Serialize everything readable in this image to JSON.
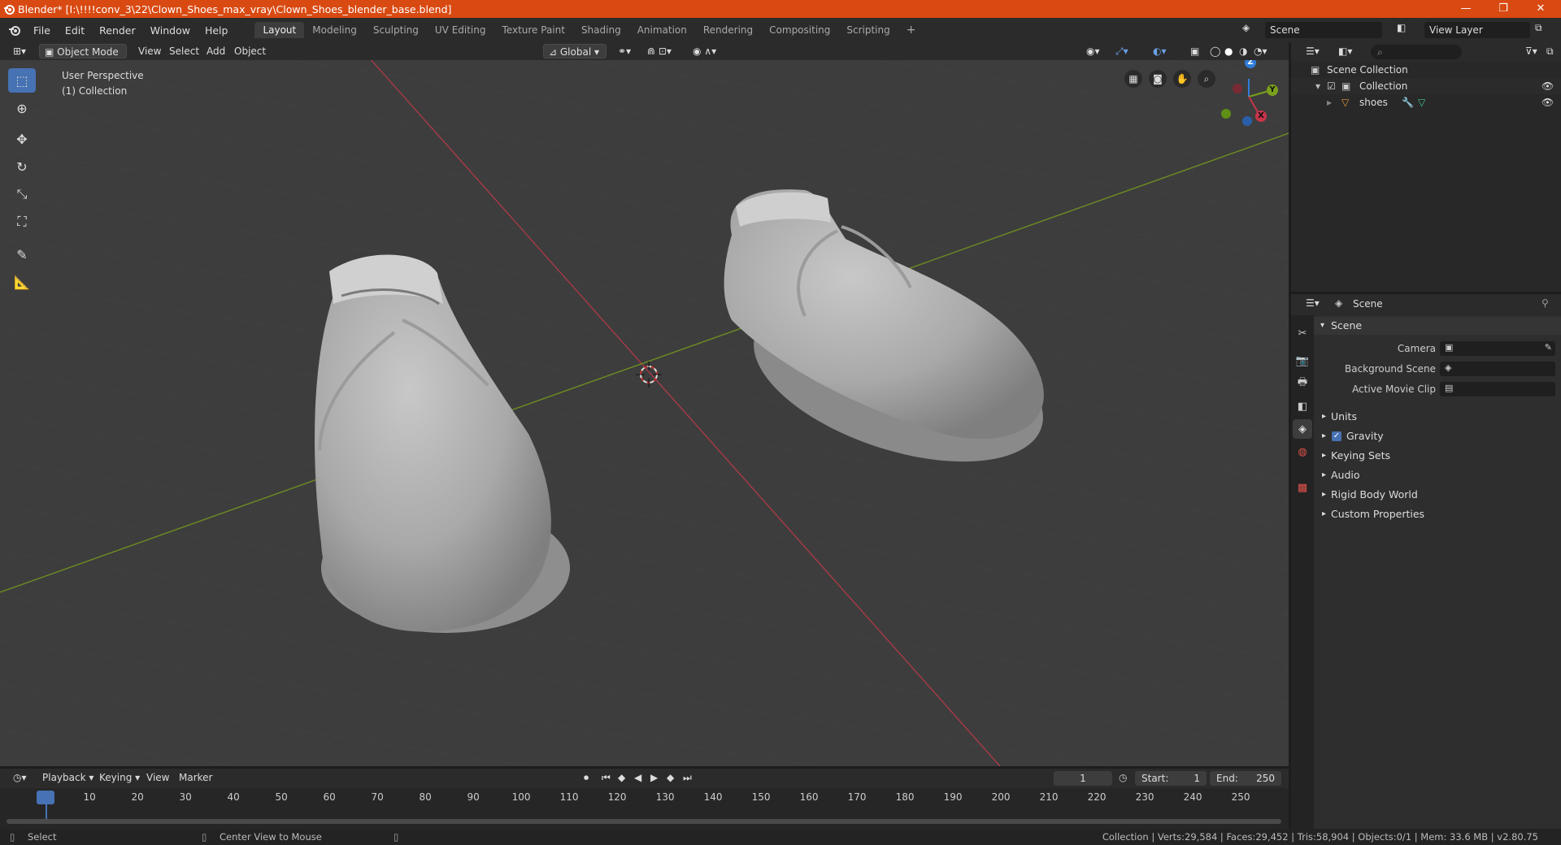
{
  "window": {
    "title": "Blender* [I:\\!!!!conv_3\\22\\Clown_Shoes_max_vray\\Clown_Shoes_blender_base.blend]",
    "controls": [
      "—",
      "❐",
      "✕"
    ]
  },
  "menu": {
    "items": [
      "File",
      "Edit",
      "Render",
      "Window",
      "Help"
    ],
    "workspaces": [
      "Layout",
      "Modeling",
      "Sculpting",
      "UV Editing",
      "Texture Paint",
      "Shading",
      "Animation",
      "Rendering",
      "Compositing",
      "Scripting"
    ],
    "active_workspace": "Layout",
    "add_tab": "+",
    "scene": "Scene",
    "view_layer": "View Layer"
  },
  "viewport_header": {
    "mode": "Object Mode",
    "menus": [
      "View",
      "Select",
      "Add",
      "Object"
    ],
    "transform_orientation": "Global"
  },
  "viewport": {
    "perspective": "User Perspective",
    "collection": "(1) Collection",
    "gizmo": {
      "z": "Z",
      "y": "Y",
      "x": "X"
    }
  },
  "outliner": {
    "rows": [
      {
        "label": "Scene Collection"
      },
      {
        "label": "Collection"
      },
      {
        "label": "shoes"
      }
    ]
  },
  "properties": {
    "context": "Scene",
    "panel": "Scene",
    "fields": [
      {
        "label": "Camera"
      },
      {
        "label": "Background Scene"
      },
      {
        "label": "Active Movie Clip"
      }
    ],
    "sections": [
      "Units",
      "Gravity",
      "Keying Sets",
      "Audio",
      "Rigid Body World",
      "Custom Properties"
    ]
  },
  "timeline": {
    "menus": [
      "Playback",
      "Keying",
      "View",
      "Marker"
    ],
    "current_frame": "1",
    "start_label": "Start:",
    "start": "1",
    "end_label": "End:",
    "end": "250",
    "ticks": [
      "1",
      "10",
      "20",
      "30",
      "40",
      "50",
      "60",
      "70",
      "80",
      "90",
      "100",
      "110",
      "120",
      "130",
      "140",
      "150",
      "160",
      "170",
      "180",
      "190",
      "200",
      "210",
      "220",
      "230",
      "240",
      "250"
    ]
  },
  "statusbar": {
    "left": "Select",
    "middle": "Center View to Mouse",
    "right": "Collection | Verts:29,584 | Faces:29,452 | Tris:58,904 | Objects:0/1 | Mem: 33.6 MB | v2.80.75"
  },
  "colors": {
    "titlebar": "#d94a12",
    "accent": "#4772b3",
    "x_axis": "#c8344a",
    "y_axis": "#7aa01c",
    "z_axis": "#2f7cd9"
  }
}
